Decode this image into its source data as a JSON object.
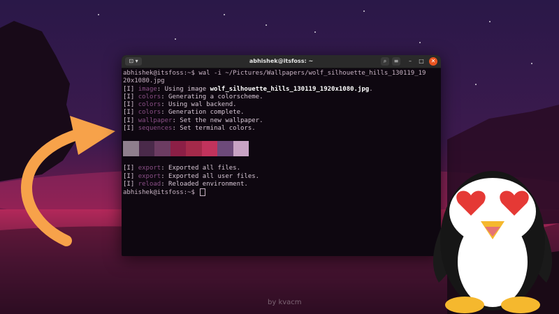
{
  "terminal": {
    "title": "abhishek@itsfoss: ~",
    "tab_icon": "⊡ ▾",
    "lines": [
      {
        "a": "abhishek@itsfoss:~$ wal -i ~/Pictures/Wallpapers/wolf_silhouette_hills_130119_19",
        "kind": "cmd"
      },
      {
        "a": "20x1080.jpg",
        "kind": "cmd"
      },
      {
        "pre": "[I] ",
        "mod": "image",
        "txt": ": Using image ",
        "extra": "wolf_silhouette_hills_130119_1920x1080.jpg",
        "post": "."
      },
      {
        "pre": "[I] ",
        "mod": "colors",
        "txt": ": Generating a colorscheme."
      },
      {
        "pre": "[I] ",
        "mod": "colors",
        "txt": ": Using wal backend."
      },
      {
        "pre": "[I] ",
        "mod": "colors",
        "txt": ": Generation complete."
      },
      {
        "pre": "[I] ",
        "mod": "wallpaper",
        "txt": ": Set the new wallpaper."
      },
      {
        "pre": "[I] ",
        "mod": "sequences",
        "txt": ": Set terminal colors."
      }
    ],
    "palette": [
      "#8f7f8d",
      "#4a2a4a",
      "#6c3c62",
      "#8c1f46",
      "#a42a4a",
      "#c1335c",
      "#6d4a7a",
      "#c8a3c4"
    ],
    "lines2": [
      {
        "pre": "[I] ",
        "mod": "export",
        "txt": ": Exported all files."
      },
      {
        "pre": "[I] ",
        "mod": "export",
        "txt": ": Exported all user files."
      },
      {
        "pre": "[I] ",
        "mod": "reload",
        "txt": ": Reloaded environment."
      }
    ],
    "prompt": "abhishek@itsfoss:~$"
  },
  "watermark": "by kvacm",
  "icons": [
    "terminal-tab-icon",
    "search-icon",
    "menu-icon",
    "minimize-icon",
    "maximize-icon",
    "close-icon",
    "arrow-graphic",
    "penguin-graphic"
  ],
  "colors": {
    "accent": "#e95420",
    "arrow": "#f7a24a"
  }
}
